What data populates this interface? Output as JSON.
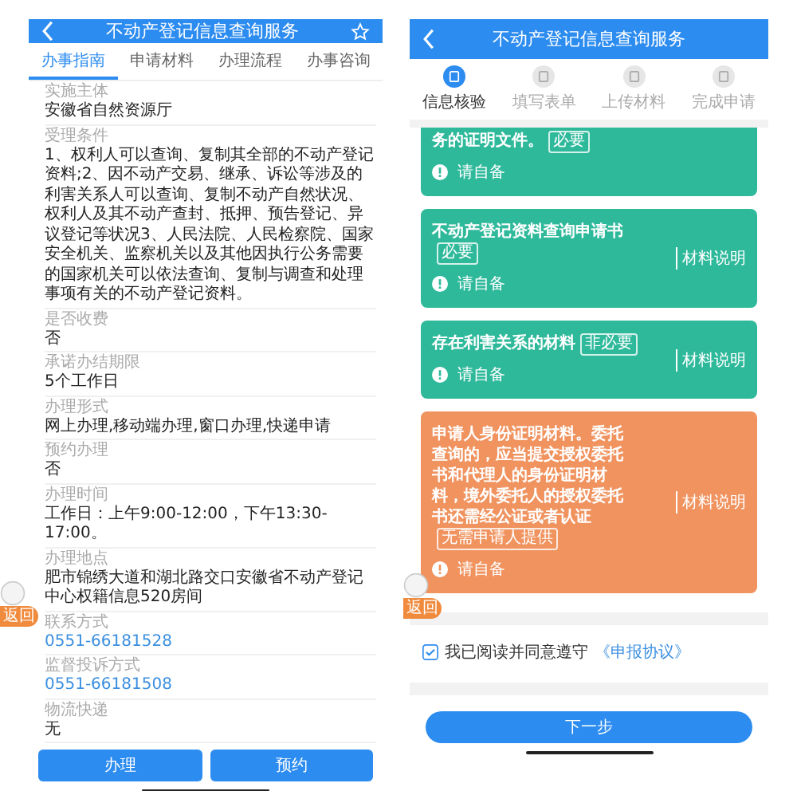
{
  "left": {
    "title": "不动产登记信息查询服务",
    "tabs": [
      {
        "label": "办事指南",
        "selected": true
      },
      {
        "label": "申请材料",
        "selected": false
      },
      {
        "label": "办理流程",
        "selected": false
      },
      {
        "label": "办事咨询",
        "selected": false
      }
    ],
    "fields": [
      {
        "label": "实施主体",
        "value": "安徽省自然资源厅",
        "kind": "text"
      },
      {
        "label": "受理条件",
        "value": "1、权利人可以查询、复制其全部的不动产登记资料;2、因不动产交易、继承、诉讼等涉及的利害关系人可以查询、复制不动产自然状况、权利人及其不动产查封、抵押、预告登记、异议登记等状况3、人民法院、人民检察院、国家安全机关、监察机关以及其他因执行公务需要的国家机关可以依法查询、复制与调查和处理事项有关的不动产登记资料。",
        "kind": "text"
      },
      {
        "label": "是否收费",
        "value": "否",
        "kind": "text"
      },
      {
        "label": "承诺办结期限",
        "value": "5个工作日",
        "kind": "text"
      },
      {
        "label": "办理形式",
        "value": "网上办理,移动端办理,窗口办理,快递申请",
        "kind": "text"
      },
      {
        "label": "预约办理",
        "value": "否",
        "kind": "text"
      },
      {
        "label": "办理时间",
        "value": "工作日：上午9:00-12:00，下午13:30-17:00。",
        "kind": "text"
      },
      {
        "label": "办理地点",
        "value": "肥市锦绣大道和湖北路交口安徽省不动产登记中心权籍信息520房间",
        "kind": "text"
      },
      {
        "label": "联系方式",
        "value": "0551-66181528",
        "kind": "link"
      },
      {
        "label": "监督投诉方式",
        "value": "0551-66181508",
        "kind": "link"
      },
      {
        "label": "物流快递",
        "value": "无",
        "kind": "text"
      }
    ],
    "buttons": [
      "办理",
      "预约"
    ],
    "float_badge": "返回"
  },
  "right": {
    "title": "不动产登记信息查询服务",
    "steps": [
      {
        "label": "信息核验",
        "selected": true
      },
      {
        "label": "填写表单",
        "selected": false
      },
      {
        "label": "上传材料",
        "selected": false
      },
      {
        "label": "完成申请",
        "selected": false
      }
    ],
    "cards": [
      {
        "title": "务的证明文件。",
        "tag": "必要",
        "note": "请自备",
        "color": "#2fb99b"
      },
      {
        "title": "不动产登记资料查询申请书",
        "tag": "必要",
        "note": "请自备",
        "link": "材料说明",
        "color": "#2fb99b"
      },
      {
        "title": "存在利害关系的材料",
        "tag": "非必要",
        "note": "请自备",
        "link": "材料说明",
        "color": "#2fb99b"
      },
      {
        "title": "申请人身份证明材料。委托查询的，应当提交授权委托书和代理人的身份证明材料，境外委托人的授权委托书还需经公证或者认证",
        "tag": "无需申请人提供",
        "note": "请自备",
        "link": "材料说明",
        "color": "#f0935f"
      }
    ],
    "agreement": {
      "checked": true,
      "text": "我已阅读并同意遵守",
      "link": "《申报协议》"
    },
    "next_button": "下一步",
    "float_badge": "返回"
  }
}
